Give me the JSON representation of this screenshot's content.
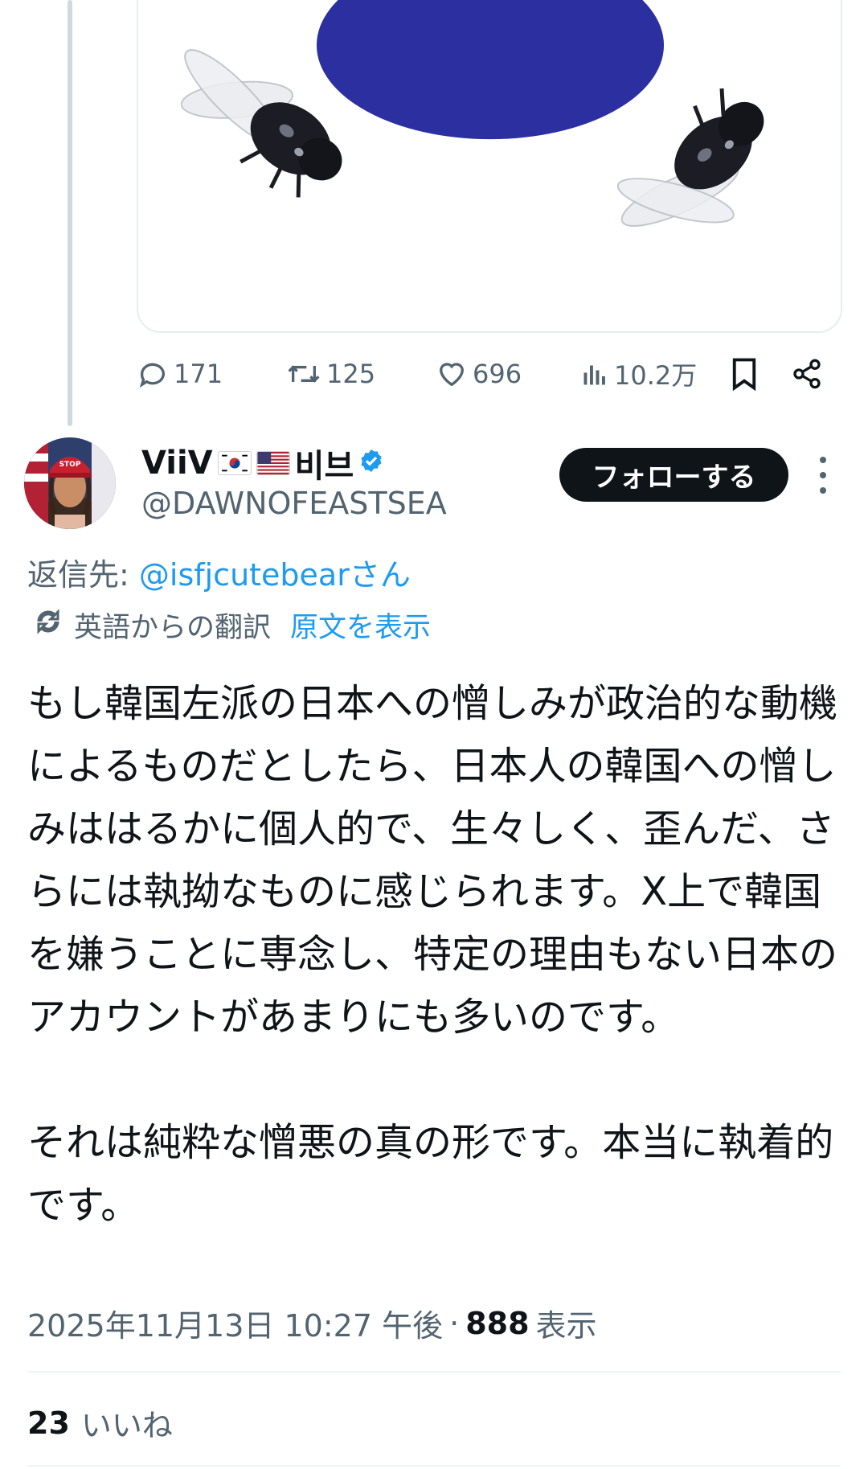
{
  "previous_tweet": {
    "stats": {
      "replies": "171",
      "retweets": "125",
      "likes": "696",
      "views": "10.2万"
    }
  },
  "tweet": {
    "display_name": "ViiV",
    "display_name_suffix": "비브",
    "handle": "@DAWNOFEASTSEA",
    "follow_label": "フォローする",
    "reply_to_prefix": "返信先: ",
    "reply_to_user": "@isfjcutebear",
    "reply_to_suffix": "さん",
    "translation_label": "英語からの翻訳",
    "show_original_label": "原文を表示",
    "text_paragraph_1": "もし韓国左派の日本への憎しみが政治的な動機によるものだとしたら、日本人の韓国への憎しみははるかに個人的で、生々しく、歪んだ、さらには執拗なものに感じられます。X上で韓国を嫌うことに専念し、特定の理由もない日本のアカウントがあまりにも多いのです。",
    "text_paragraph_2": "それは純粋な憎悪の真の形です。本当に執着的です。",
    "timestamp": "2025年11月13日 10:27 午後",
    "separator": "·",
    "views_count": "888",
    "views_label": "表示",
    "likes_count": "23",
    "likes_label": "いいね"
  },
  "colors": {
    "text_primary": "#0f1419",
    "text_secondary": "#536471",
    "link": "#1d9bf0",
    "verified": "#1d9bf0",
    "follow_button_bg": "#0f1419",
    "blue_shape": "#2b2fa0"
  },
  "icons": [
    "reply-icon",
    "retweet-icon",
    "like-icon",
    "views-icon",
    "bookmark-icon",
    "share-icon",
    "verified-badge-icon",
    "translate-icon",
    "more-icon"
  ]
}
